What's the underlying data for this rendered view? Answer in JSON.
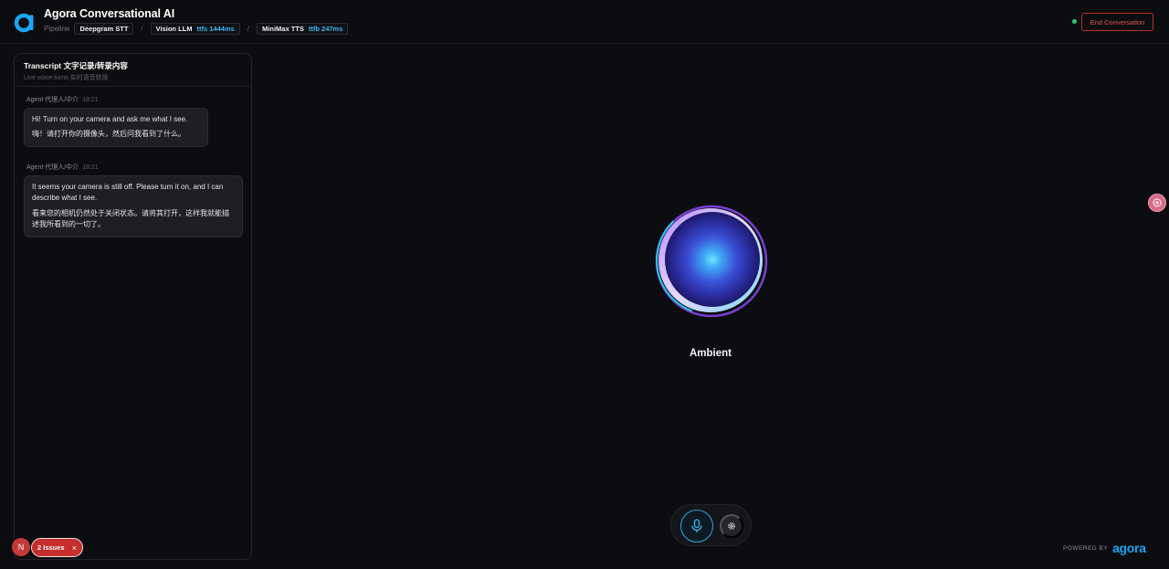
{
  "header": {
    "title": "Agora Conversational AI",
    "pipeline_label": "Pipeline",
    "stt": "Deepgram STT",
    "llm": "Vision LLM",
    "llm_metric": "ttfs 1444ms",
    "tts": "MiniMax TTS",
    "tts_metric": "ttfb 247ms",
    "separator": "/",
    "end_button": "End Conversation",
    "status_color": "#2ecc71",
    "accent_color": "#3cb7f0"
  },
  "transcript": {
    "title": "Transcript 文字记录/转录内容",
    "subtitle": "Live voice turns 实时语音转换",
    "messages": [
      {
        "speaker": "Agent 代理人/中介",
        "time": "18:21",
        "en": "Hi! Turn on your camera and ask me what I see.",
        "zh": "嗨！请打开你的摄像头，然后问我看到了什么。"
      },
      {
        "speaker": "Agent 代理人/中介",
        "time": "18:21",
        "en": "It seems your camera is still off. Please turn it on, and I can describe what I see.",
        "zh": "看来您的相机仍然处于关闭状态。请将其打开，这样我就能描述我所看到的一切了。"
      }
    ]
  },
  "orb": {
    "state_label": "Ambient"
  },
  "controls": {
    "mic_icon": "microphone-icon",
    "settings_icon": "gear-icon"
  },
  "footer": {
    "powered_by": "POWERED BY",
    "brand": "agora"
  },
  "issues": {
    "badge_letter": "N",
    "label": "2 Issues",
    "close": "×"
  }
}
